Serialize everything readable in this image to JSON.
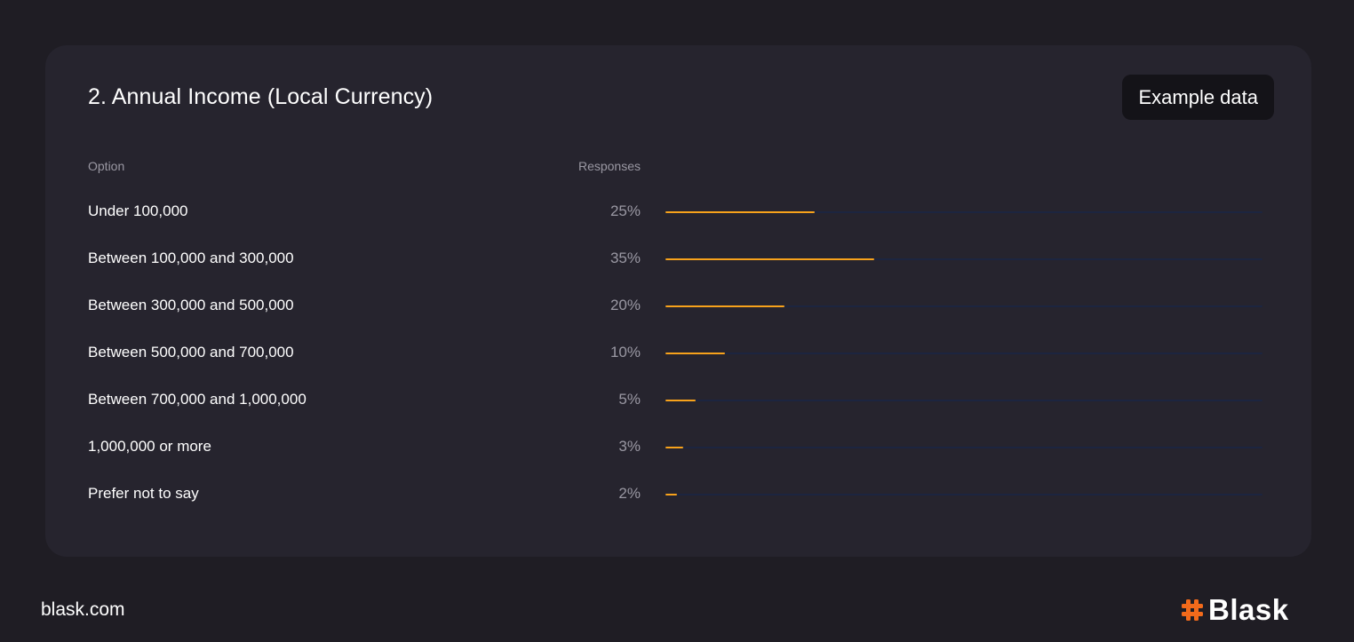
{
  "card": {
    "title": "2. Annual Income (Local Currency)",
    "badge": "Example data",
    "column_option": "Option",
    "column_responses": "Responses"
  },
  "footer": {
    "url": "blask.com",
    "logo": "Blask",
    "logo_icon": "hash-icon",
    "logo_color": "#f26a1b"
  },
  "colors": {
    "bar_fill": "#f7a21b",
    "bar_track": "#1c2540",
    "card_bg": "#26242e",
    "page_bg": "#1f1d24"
  },
  "chart_data": {
    "type": "bar",
    "orientation": "horizontal",
    "title": "2. Annual Income (Local Currency)",
    "categories": [
      "Under 100,000",
      "Between 100,000 and 300,000",
      "Between 300,000 and 500,000",
      "Between 500,000 and 700,000",
      "Between 700,000 and 1,000,000",
      "1,000,000 or more",
      "Prefer not to say"
    ],
    "values": [
      25,
      35,
      20,
      10,
      5,
      3,
      2
    ],
    "value_labels": [
      "25%",
      "35%",
      "20%",
      "10%",
      "5%",
      "3%",
      "2%"
    ],
    "unit": "%",
    "xlim": [
      0,
      100
    ],
    "grid": false,
    "legend": "none"
  }
}
